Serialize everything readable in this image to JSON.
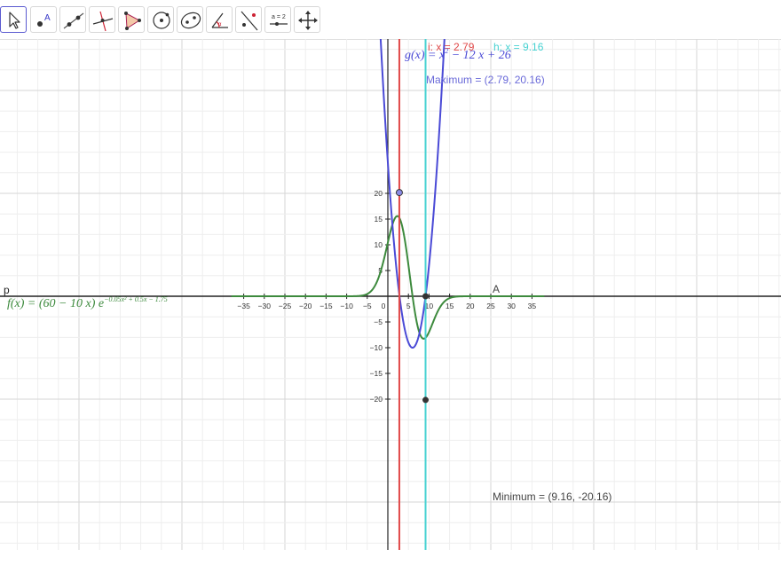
{
  "toolbar": {
    "tools": [
      {
        "name": "move-tool-icon"
      },
      {
        "name": "point-tool-icon"
      },
      {
        "name": "line-tool-icon"
      },
      {
        "name": "perpendicular-line-tool-icon"
      },
      {
        "name": "polygon-tool-icon"
      },
      {
        "name": "circle-tool-icon"
      },
      {
        "name": "ellipse-tool-icon"
      },
      {
        "name": "angle-tool-icon"
      },
      {
        "name": "reflect-tool-icon"
      },
      {
        "name": "slider-tool-icon"
      },
      {
        "name": "move-graphics-view-tool-icon"
      }
    ],
    "slider_tool_label": "a = 2"
  },
  "graph": {
    "x_ticks": [
      "−35",
      "−30",
      "−25",
      "−20",
      "−15",
      "−10",
      "−5",
      "0",
      "5",
      "10",
      "15",
      "20",
      "25",
      "30",
      "35"
    ],
    "y_ticks": [
      "20",
      "15",
      "10",
      "5",
      "−5",
      "−10",
      "−15",
      "−20"
    ],
    "x_axis_label": "p",
    "g_formula_main": "g(x) = x",
    "g_formula_sup": "2",
    "g_formula_rest": " − 12 x + 26",
    "f_formula_main": "f(x) = (60 − 10 x) e",
    "f_formula_sup": "−0.05x² + 0.5x − 1.75",
    "line_i_label": "i: x = 2.79",
    "line_h_label": "h: x = 9.16",
    "maximum_label": "Maximum = (2.79, 20.16)",
    "minimum_label": "Minimum = (9.16, -20.16)",
    "point_a_label": "A",
    "colors": {
      "g": "#4a4ad6",
      "f": "#3d8a3d",
      "line_i": "#e04848",
      "line_h": "#46d2d2",
      "axis": "#222222",
      "grid_major": "#d6d6d6",
      "grid_minor": "#eeeeee",
      "maximum_label": "#6a6ad9",
      "minimum_label": "#444444"
    },
    "line_i_x": 2.79,
    "line_h_x": 9.16,
    "maximum": [
      2.79,
      20.16
    ],
    "minimum": [
      9.16,
      -20.16
    ],
    "point_a": [
      9.16,
      0
    ]
  }
}
